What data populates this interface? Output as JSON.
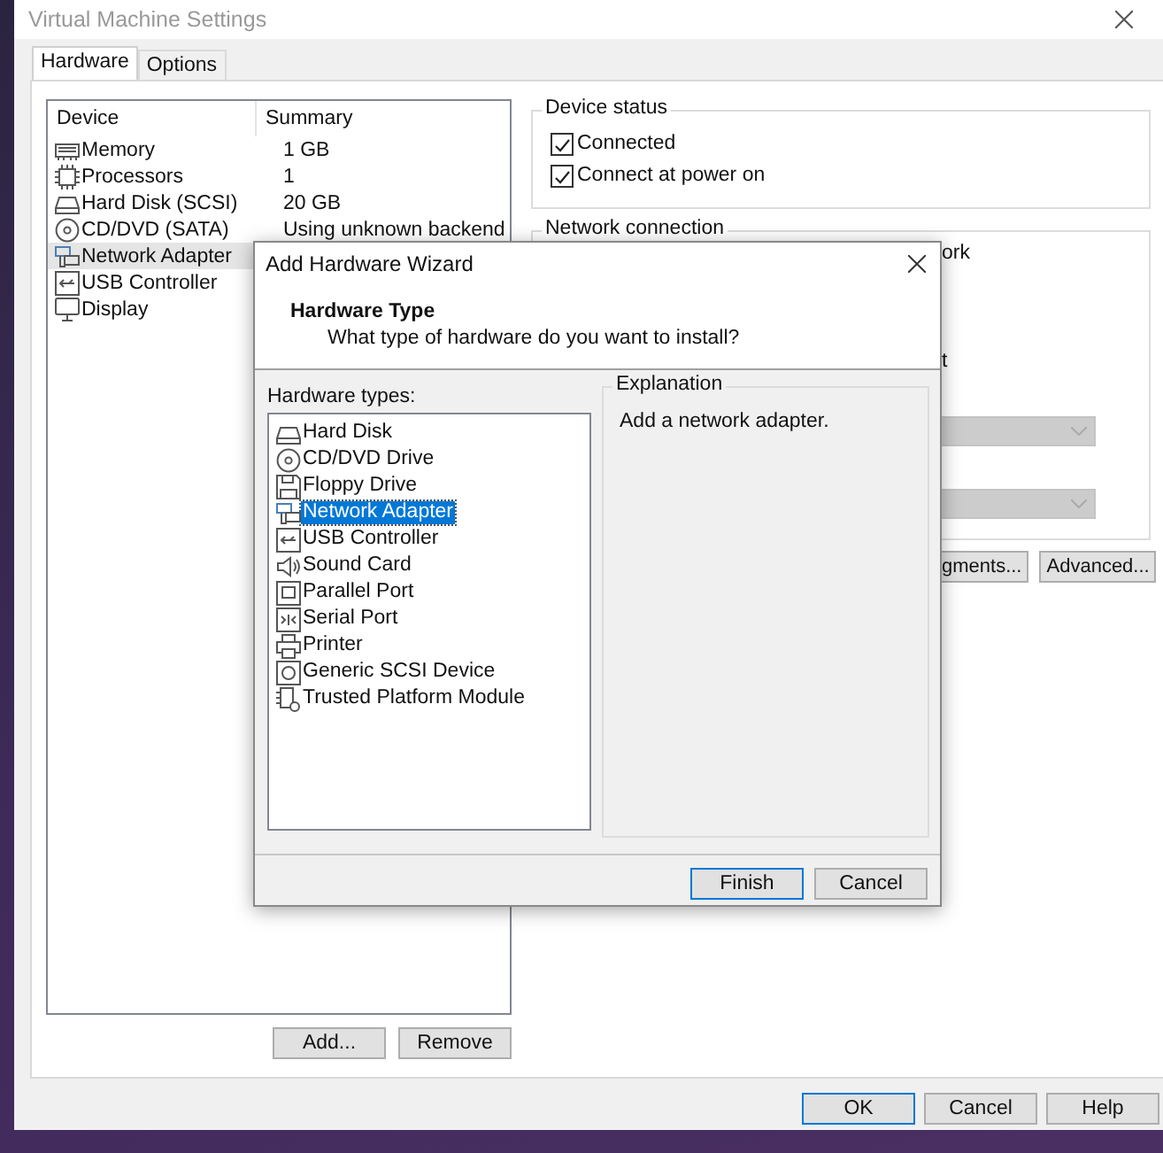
{
  "window": {
    "title": "Virtual Machine Settings"
  },
  "tabs": [
    {
      "label": "Hardware",
      "selected": true
    },
    {
      "label": "Options",
      "selected": false
    }
  ],
  "device_list": {
    "columns": [
      "Device",
      "Summary"
    ],
    "rows": [
      {
        "device": "Memory",
        "summary": "1 GB",
        "selected": false
      },
      {
        "device": "Processors",
        "summary": "1",
        "selected": false
      },
      {
        "device": "Hard Disk (SCSI)",
        "summary": "20 GB",
        "selected": false
      },
      {
        "device": "CD/DVD (SATA)",
        "summary": "Using unknown backend",
        "selected": false
      },
      {
        "device": "Network Adapter",
        "selected": true
      },
      {
        "device": "USB Controller",
        "selected": false
      },
      {
        "device": "Display",
        "selected": false
      }
    ]
  },
  "device_buttons": [
    "Add...",
    "Remove"
  ],
  "device_status": {
    "title": "Device status",
    "options": [
      {
        "label": "Connected",
        "checked": true
      },
      {
        "label": "Connect at power on",
        "checked": true
      }
    ]
  },
  "network_connection": {
    "title": "Network connection",
    "fragments": [
      "ork",
      "t"
    ],
    "dropdowns": [
      {
        "disabled": true
      },
      {
        "disabled": true
      }
    ]
  },
  "network_buttons": [
    "gments...",
    "Advanced..."
  ],
  "buttons": [
    {
      "label": "OK",
      "default": true
    },
    {
      "label": "Cancel",
      "default": false
    },
    {
      "label": "Help",
      "default": false
    }
  ],
  "wizard": {
    "title": "Add Hardware Wizard",
    "heading": "Hardware Type",
    "subheading": "What type of hardware do you want to install?",
    "types_label": "Hardware types:",
    "types": [
      {
        "label": "Hard Disk",
        "selected": false
      },
      {
        "label": "CD/DVD Drive",
        "selected": false
      },
      {
        "label": "Floppy Drive",
        "selected": false
      },
      {
        "label": "Network Adapter",
        "selected": true
      },
      {
        "label": "USB Controller",
        "selected": false
      },
      {
        "label": "Sound Card",
        "selected": false
      },
      {
        "label": "Parallel Port",
        "selected": false
      },
      {
        "label": "Serial Port",
        "selected": false
      },
      {
        "label": "Printer",
        "selected": false
      },
      {
        "label": "Generic SCSI Device",
        "selected": false
      },
      {
        "label": "Trusted Platform Module",
        "selected": false
      }
    ],
    "explanation_title": "Explanation",
    "explanation": "Add a network adapter.",
    "buttons": [
      {
        "label": "Finish",
        "default": true
      },
      {
        "label": "Cancel",
        "default": false
      }
    ]
  }
}
